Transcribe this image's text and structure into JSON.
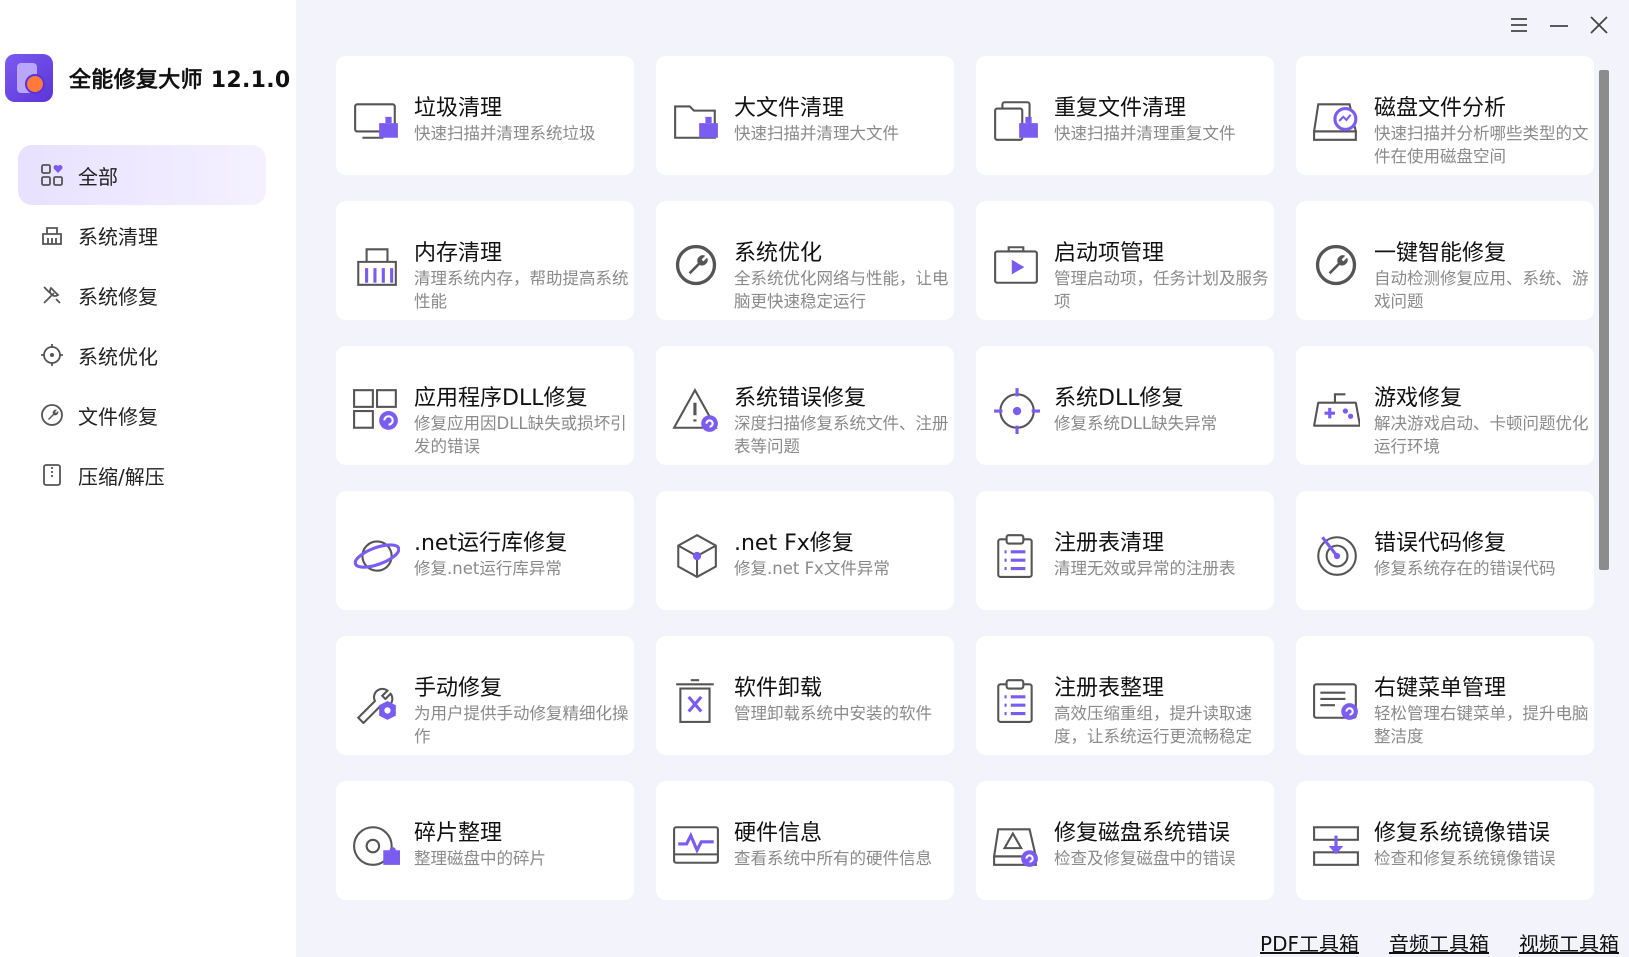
{
  "app": {
    "title": "全能修复大师 12.1.0"
  },
  "colors": {
    "accent": "#7b5cf0",
    "icon_gray": "#555555",
    "desc": "#8a8a8a",
    "bg": "#f3f4fb"
  },
  "sidebar": {
    "items": [
      {
        "label": "全部",
        "icon": "grid-heart-icon",
        "active": true
      },
      {
        "label": "系统清理",
        "icon": "broom-icon",
        "active": false
      },
      {
        "label": "系统修复",
        "icon": "tools-icon",
        "active": false
      },
      {
        "label": "系统优化",
        "icon": "target-icon",
        "active": false
      },
      {
        "label": "文件修复",
        "icon": "wrench-circle-icon",
        "active": false
      },
      {
        "label": "压缩/解压",
        "icon": "zip-file-icon",
        "active": false
      }
    ]
  },
  "tools": [
    {
      "title": "垃圾清理",
      "desc": "快速扫描并清理系统垃圾",
      "icon": "monitor-broom-icon"
    },
    {
      "title": "大文件清理",
      "desc": "快速扫描并清理大文件",
      "icon": "folder-broom-icon"
    },
    {
      "title": "重复文件清理",
      "desc": "快速扫描并清理重复文件",
      "icon": "files-broom-icon"
    },
    {
      "title": "磁盘文件分析",
      "desc": "快速扫描并分析哪些类型的文件在使用磁盘空间",
      "icon": "disk-analysis-icon"
    },
    {
      "title": "内存清理",
      "desc": "清理系统内存，帮助提高系统性能",
      "icon": "memory-broom-icon"
    },
    {
      "title": "系统优化",
      "desc": "全系统优化网络与性能，让电脑更快速稳定运行",
      "icon": "wrench-circle-icon"
    },
    {
      "title": "启动项管理",
      "desc": "管理启动项，任务计划及服务项",
      "icon": "startup-play-icon"
    },
    {
      "title": "一键智能修复",
      "desc": "自动检测修复应用、系统、游戏问题",
      "icon": "wrench-circle-icon"
    },
    {
      "title": "应用程序DLL修复",
      "desc": "修复应用因DLL缺失或损坏引发的错误",
      "icon": "app-dll-icon"
    },
    {
      "title": "系统错误修复",
      "desc": "深度扫描修复系统文件、注册表等问题",
      "icon": "warning-icon"
    },
    {
      "title": "系统DLL修复",
      "desc": "修复系统DLL缺失异常",
      "icon": "crosshair-icon"
    },
    {
      "title": "游戏修复",
      "desc": "解决游戏启动、卡顿问题优化运行环境",
      "icon": "gamepad-icon"
    },
    {
      "title": ".net运行库修复",
      "desc": "修复.net运行库异常",
      "icon": "planet-icon"
    },
    {
      "title": ".net Fx修复",
      "desc": "修复.net Fx文件异常",
      "icon": "cube-icon"
    },
    {
      "title": "注册表清理",
      "desc": "清理无效或异常的注册表",
      "icon": "clipboard-list-icon"
    },
    {
      "title": "错误代码修复",
      "desc": "修复系统存在的错误代码",
      "icon": "radar-icon"
    },
    {
      "title": "手动修复",
      "desc": "为用户提供手动修复精细化操作",
      "icon": "wrench-hex-icon"
    },
    {
      "title": "软件卸载",
      "desc": "管理卸载系统中安装的软件",
      "icon": "trash-x-icon"
    },
    {
      "title": "注册表整理",
      "desc": "高效压缩重组，提升读取速度，让系统运行更流畅稳定",
      "icon": "clipboard-list-icon"
    },
    {
      "title": "右键菜单管理",
      "desc": "轻松管理右键菜单，提升电脑整洁度",
      "icon": "menu-window-icon"
    },
    {
      "title": "碎片整理",
      "desc": "整理磁盘中的碎片",
      "icon": "disc-puzzle-icon"
    },
    {
      "title": "硬件信息",
      "desc": "查看系统中所有的硬件信息",
      "icon": "monitor-pulse-icon"
    },
    {
      "title": "修复磁盘系统错误",
      "desc": "检查及修复磁盘中的错误",
      "icon": "disk-warning-icon"
    },
    {
      "title": "修复系统镜像错误",
      "desc": "检查和修复系统镜像错误",
      "icon": "drive-download-icon"
    }
  ],
  "footer": {
    "links": [
      "PDF工具箱",
      "音频工具箱",
      "视频工具箱"
    ]
  }
}
